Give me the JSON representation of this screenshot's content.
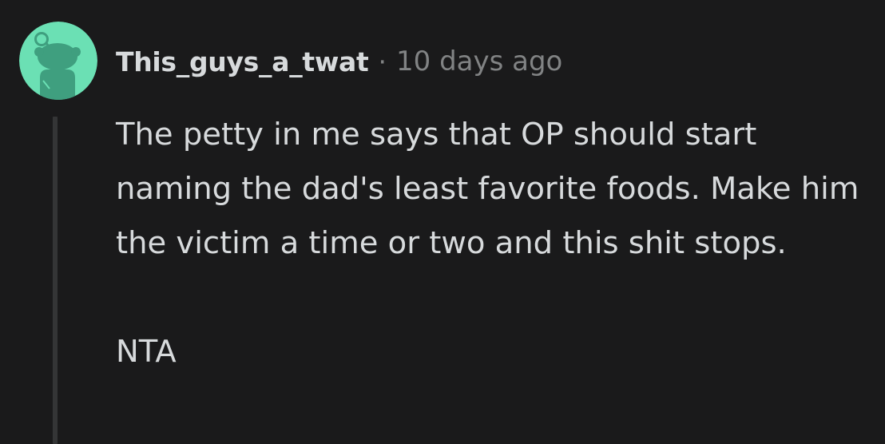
{
  "comment": {
    "username": "This_guys_a_twat",
    "separator": "·",
    "timestamp": "10 days ago",
    "paragraphs": [
      "The petty in me says that OP should start naming the dad's least favorite foods. Make him the victim a time or two and this shit stops.",
      "NTA"
    ],
    "avatar_icon": "reddit-snoo-avatar-icon"
  },
  "colors": {
    "background": "#1a1a1b",
    "text": "#d7dadc",
    "muted": "#818384",
    "thread_line": "#343536",
    "avatar_bg": "#6be0b4",
    "avatar_fg": "#3f9f7f"
  }
}
